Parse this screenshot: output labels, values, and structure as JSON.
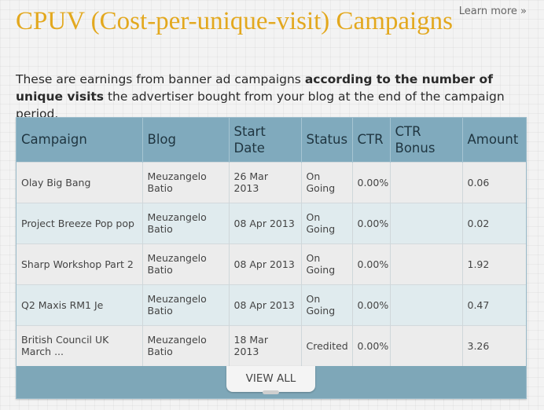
{
  "header": {
    "title": "CPUV (Cost-per-unique-visit) Campaigns",
    "learn_more": "Learn more »"
  },
  "intro": {
    "text_before": "These are earnings from banner ad campaigns ",
    "text_bold": "according to the number of unique visits",
    "text_after": " the advertiser bought from your blog at the end of the campaign period."
  },
  "table": {
    "columns": {
      "campaign": "Campaign",
      "blog": "Blog",
      "start_date": "Start Date",
      "status": "Status",
      "ctr": "CTR",
      "ctr_bonus": "CTR Bonus",
      "amount": "Amount"
    },
    "rows": [
      {
        "campaign": "Olay Big Bang",
        "blog": "Meuzangelo Batio",
        "start_date": "26 Mar 2013",
        "status": "On Going",
        "ctr": "0.00%",
        "ctr_bonus": "",
        "amount": "0.06"
      },
      {
        "campaign": "Project Breeze Pop pop",
        "blog": "Meuzangelo Batio",
        "start_date": "08 Apr 2013",
        "status": "On Going",
        "ctr": "0.00%",
        "ctr_bonus": "",
        "amount": "0.02"
      },
      {
        "campaign": "Sharp Workshop Part 2",
        "blog": "Meuzangelo Batio",
        "start_date": "08 Apr 2013",
        "status": "On Going",
        "ctr": "0.00%",
        "ctr_bonus": "",
        "amount": "1.92"
      },
      {
        "campaign": "Q2 Maxis RM1 Je",
        "blog": "Meuzangelo Batio",
        "start_date": "08 Apr 2013",
        "status": "On Going",
        "ctr": "0.00%",
        "ctr_bonus": "",
        "amount": "0.47"
      },
      {
        "campaign": "British Council UK March ...",
        "blog": "Meuzangelo Batio",
        "start_date": "18 Mar 2013",
        "status": "Credited",
        "ctr": "0.00%",
        "ctr_bonus": "",
        "amount": "3.26"
      }
    ],
    "view_all": "VIEW ALL"
  }
}
